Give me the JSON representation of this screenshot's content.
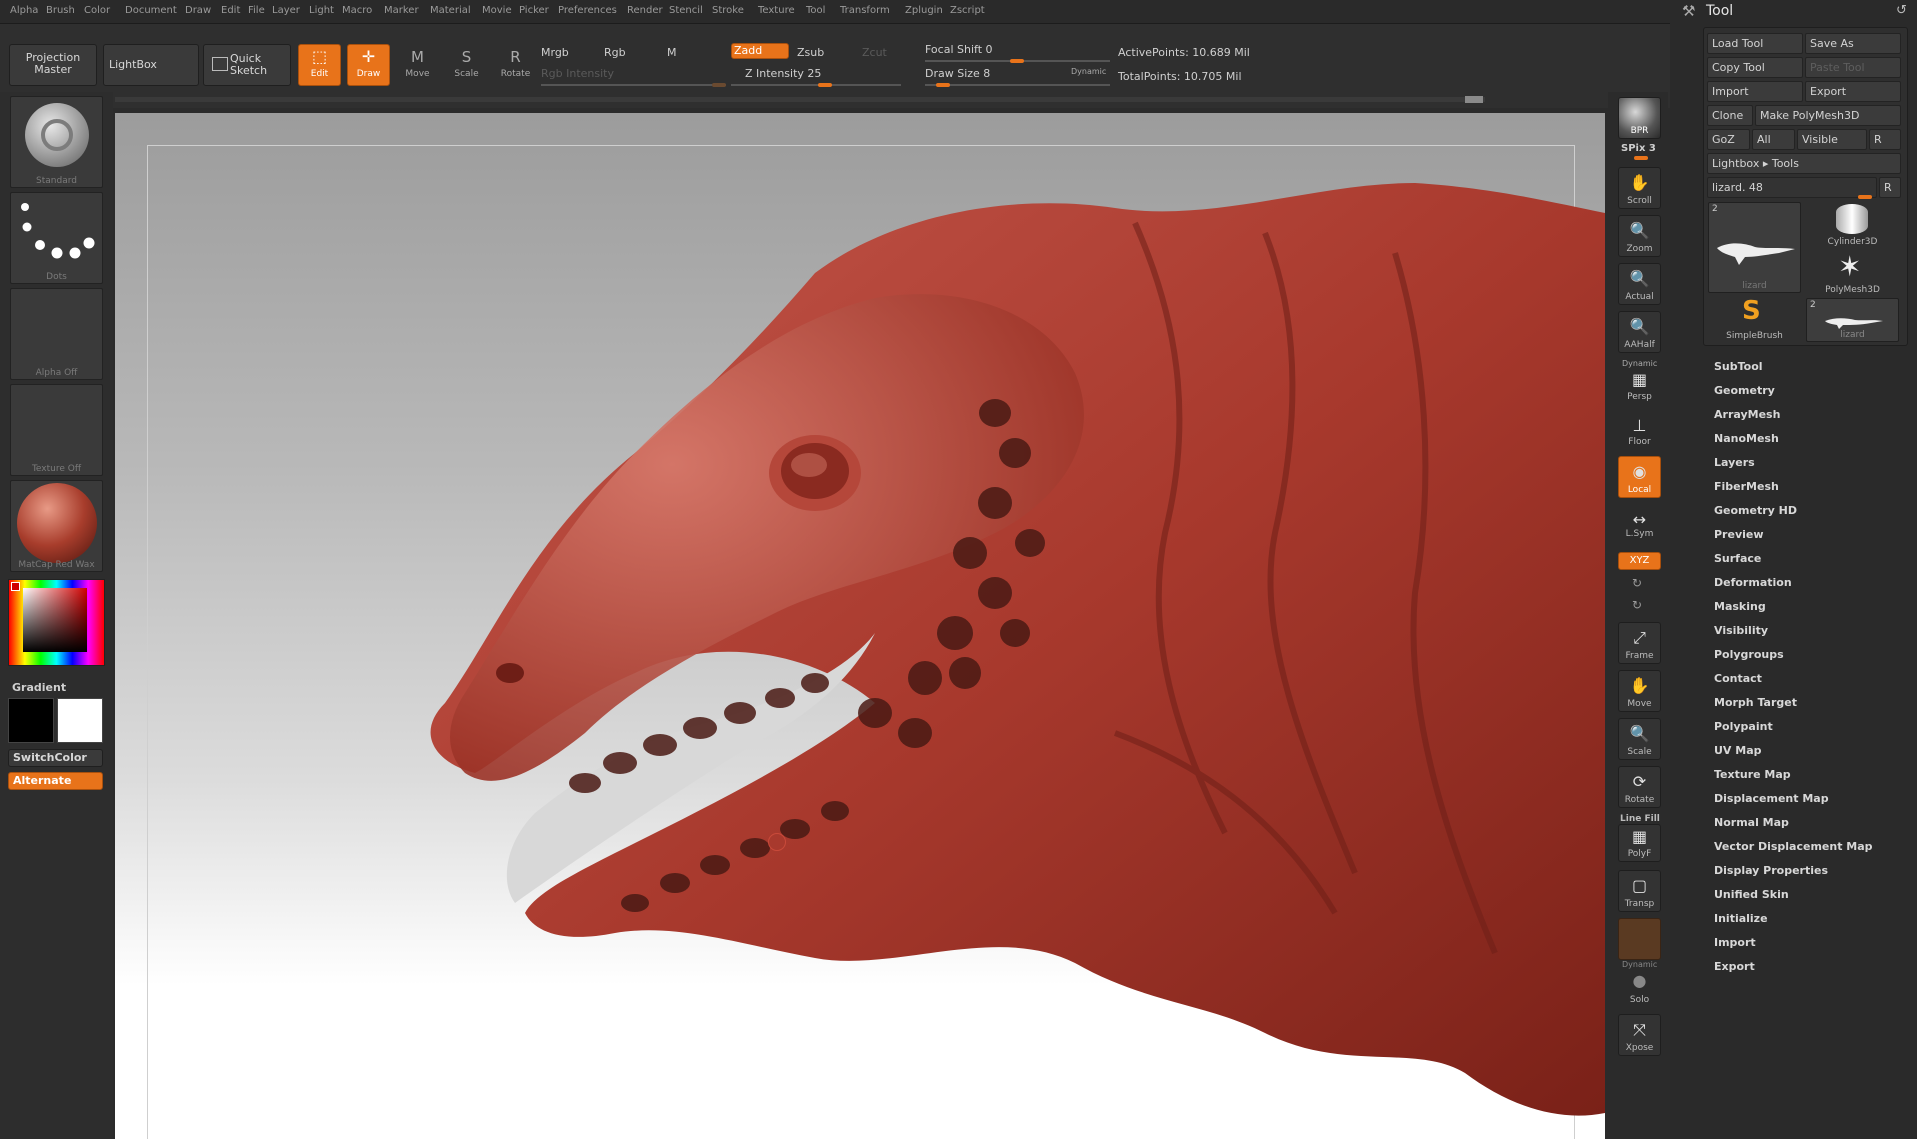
{
  "menu": [
    "Alpha",
    "Brush",
    "Color",
    "Document",
    "Draw",
    "Edit",
    "File",
    "Layer",
    "Light",
    "Macro",
    "Marker",
    "Material",
    "Movie",
    "Picker",
    "Preferences",
    "Render",
    "Stencil",
    "Stroke",
    "Texture",
    "Tool",
    "Transform",
    "Zplugin",
    "Zscript"
  ],
  "toolbar": {
    "projection_master": "Projection Master",
    "lightbox": "LightBox",
    "quick_sketch": "Quick Sketch",
    "edit": "Edit",
    "draw": "Draw",
    "move": "Move",
    "scale": "Scale",
    "rotate": "Rotate",
    "mrgb": "Mrgb",
    "rgb": "Rgb",
    "m": "M",
    "zadd": "Zadd",
    "zsub": "Zsub",
    "zcut": "Zcut",
    "rgb_intensity": "Rgb Intensity",
    "z_intensity": "Z Intensity 25",
    "focal_shift": "Focal Shift 0",
    "draw_size": "Draw Size 8",
    "dynamic": "Dynamic",
    "active_points": "ActivePoints: 10.689 Mil",
    "total_points": "TotalPoints: 10.705 Mil"
  },
  "left_shelf": {
    "brush": "Standard",
    "stroke": "Dots",
    "alpha": "Alpha Off",
    "texture": "Texture Off",
    "material": "MatCap Red Wax",
    "gradient": "Gradient",
    "switch_color": "SwitchColor",
    "alternate": "Alternate"
  },
  "right_shelf": [
    {
      "name": "bpr",
      "label": "",
      "icon": "BPR"
    },
    {
      "name": "scroll",
      "label": "Scroll",
      "icon": "✋"
    },
    {
      "name": "zoom",
      "label": "Zoom",
      "icon": "🔍"
    },
    {
      "name": "actual",
      "label": "Actual",
      "icon": "🔍"
    },
    {
      "name": "aahalf",
      "label": "AAHalf",
      "icon": "🔍"
    },
    {
      "name": "persp",
      "label": "Persp",
      "icon": "▦"
    },
    {
      "name": "floor",
      "label": "Floor",
      "icon": "⊥"
    },
    {
      "name": "local",
      "label": "Local",
      "icon": "◉"
    },
    {
      "name": "lsym",
      "label": "L.Sym",
      "icon": "↔"
    },
    {
      "name": "frame",
      "label": "Frame",
      "icon": "⤢"
    },
    {
      "name": "move",
      "label": "Move",
      "icon": "✋"
    },
    {
      "name": "scale",
      "label": "Scale",
      "icon": "🔍"
    },
    {
      "name": "rotate",
      "label": "Rotate",
      "icon": "⟳"
    },
    {
      "name": "polyf",
      "label": "PolyF",
      "icon": "▦"
    },
    {
      "name": "transp",
      "label": "Transp",
      "icon": "▢"
    },
    {
      "name": "ghost",
      "label": "",
      "icon": ""
    },
    {
      "name": "solo",
      "label": "Solo",
      "icon": "●"
    },
    {
      "name": "xpose",
      "label": "Xpose",
      "icon": "⤧"
    }
  ],
  "right_shelf_text": {
    "spix": "SPix 3",
    "dynamic": "Dynamic",
    "line_fill": "Line Fill",
    "xyz": "XYZ"
  },
  "tool_panel": {
    "title": "Tool",
    "buttons": {
      "load_tool": "Load Tool",
      "save_as": "Save As",
      "copy_tool": "Copy Tool",
      "paste_tool": "Paste Tool",
      "import": "Import",
      "export": "Export",
      "clone": "Clone",
      "make_polymesh": "Make PolyMesh3D",
      "goz": "GoZ",
      "all": "All",
      "visible": "Visible",
      "r": "R",
      "lightbox_tools": "Lightbox ▸ Tools",
      "current_tool": "lizard. 48",
      "r2": "R"
    },
    "tiles": [
      {
        "label": "lizard",
        "count": "2"
      },
      {
        "label": "Cylinder3D",
        "count": ""
      },
      {
        "label": "PolyMesh3D",
        "count": ""
      },
      {
        "label": "SimpleBrush",
        "count": ""
      },
      {
        "label": "lizard",
        "count": "2"
      }
    ],
    "sections": [
      "SubTool",
      "Geometry",
      "ArrayMesh",
      "NanoMesh",
      "Layers",
      "FiberMesh",
      "Geometry HD",
      "Preview",
      "Surface",
      "Deformation",
      "Masking",
      "Visibility",
      "Polygroups",
      "Contact",
      "Morph Target",
      "Polypaint",
      "UV Map",
      "Texture Map",
      "Displacement Map",
      "Normal Map",
      "Vector Displacement Map",
      "Display Properties",
      "Unified Skin",
      "Initialize",
      "Import",
      "Export"
    ]
  }
}
